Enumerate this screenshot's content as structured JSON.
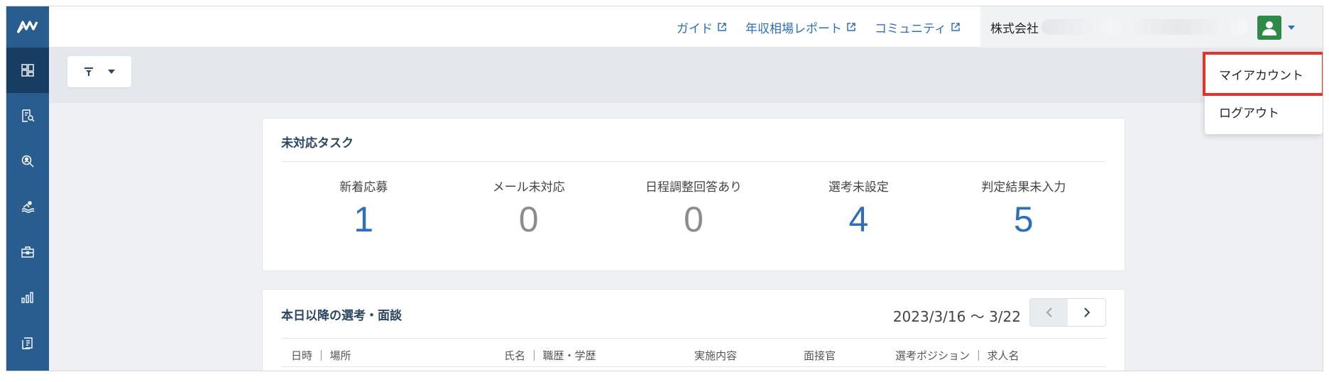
{
  "header": {
    "links": [
      {
        "label": "ガイド"
      },
      {
        "label": "年収相場レポート"
      },
      {
        "label": "コミュニティ"
      }
    ],
    "company_prefix": "株式会社"
  },
  "user_menu": {
    "items": [
      {
        "label": "マイアカウント",
        "highlighted": true
      },
      {
        "label": "ログアウト"
      }
    ],
    "highlight_color": "#e0352b"
  },
  "tasks": {
    "title": "未対応タスク",
    "items": [
      {
        "label": "新着応募",
        "value": "1",
        "color": "#2e6fb7"
      },
      {
        "label": "メール未対応",
        "value": "0",
        "color": "#8c8c8c"
      },
      {
        "label": "日程調整回答あり",
        "value": "0",
        "color": "#8c8c8c"
      },
      {
        "label": "選考未設定",
        "value": "4",
        "color": "#2e6fb7"
      },
      {
        "label": "判定結果未入力",
        "value": "5",
        "color": "#2e6fb7"
      }
    ]
  },
  "schedule": {
    "title": "本日以降の選考・面談",
    "date_range": "2023/3/16 〜 3/22",
    "columns": [
      "日時 ｜ 場所",
      "氏名 ｜ 職歴・学歴",
      "実施内容",
      "面接官",
      "選考ポジション ｜ 求人名"
    ]
  },
  "colors": {
    "sidebar": "#2a5d8f",
    "sidebar_active": "#173d63",
    "link": "#2e6fb7"
  }
}
